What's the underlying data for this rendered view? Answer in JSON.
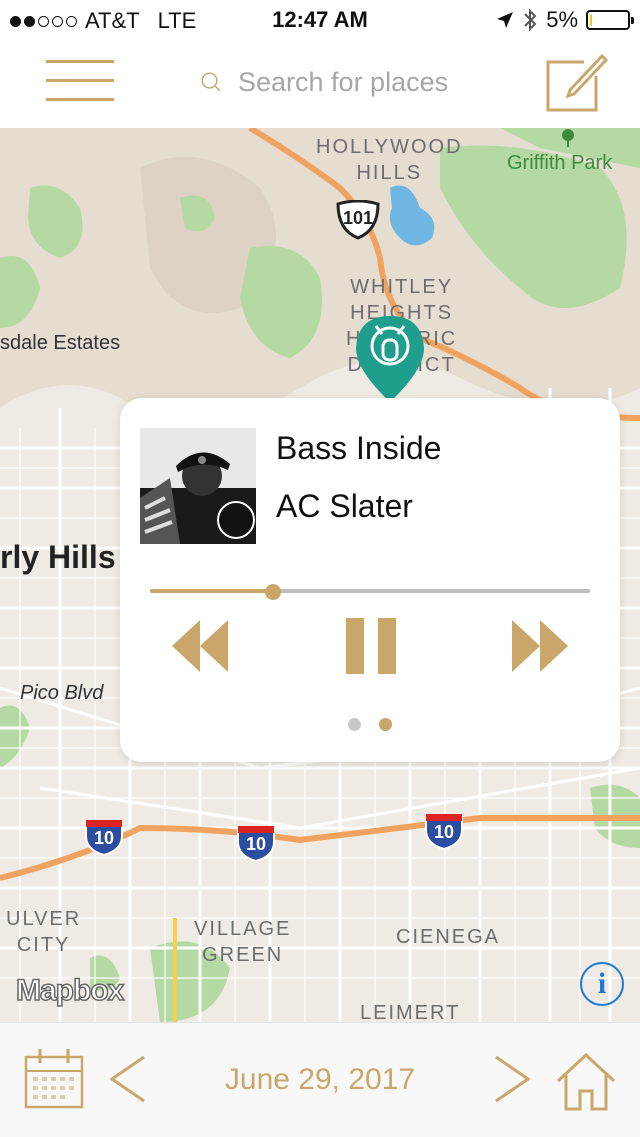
{
  "status_bar": {
    "carrier": "AT&T",
    "network": "LTE",
    "time": "12:47 AM",
    "battery": "5%",
    "battery_level": 0.05,
    "signal_bars_filled": 2,
    "signal_bars_total": 5
  },
  "navbar": {
    "menu_icon": "hamburger-icon",
    "search_placeholder": "Search for places",
    "search_icon": "search-icon",
    "compose_icon": "compose-icon"
  },
  "map": {
    "labels": {
      "hollywood_hills": "HOLLYWOOD\nHILLS",
      "griffith_park": "Griffith Park",
      "whitley_heights": "WHITLEY\nHEIGHTS\nHISTORIC\nDISTRICT",
      "estates": "sdale Estates",
      "beverly_hills": "rly Hills",
      "pico_blvd": "Pico Blvd",
      "culver_city": "ULVER\nCITY",
      "village_green": "VILLAGE\nGREEN",
      "cienega": "CIENEGA",
      "leimert": "LEIMERT"
    },
    "shields": {
      "us101": "101",
      "i10_a": "10",
      "i10_b": "10",
      "i10_c": "10"
    },
    "attribution": "Mapbox",
    "info_label": "i",
    "colors": {
      "highway": "#f0a360",
      "park": "#b5d9a3",
      "water": "#6fb6e3",
      "pin": "#1f9e8e"
    }
  },
  "player": {
    "title": "Bass Inside",
    "artist": "AC Slater",
    "progress": 0.28,
    "page_count": 2,
    "active_page": 2,
    "accent": "#c9a76a"
  },
  "bottom_bar": {
    "date": "June 29, 2017",
    "calendar_icon": "calendar-icon",
    "prev_icon": "chevron-left-icon",
    "next_icon": "chevron-right-icon",
    "home_icon": "home-icon"
  }
}
